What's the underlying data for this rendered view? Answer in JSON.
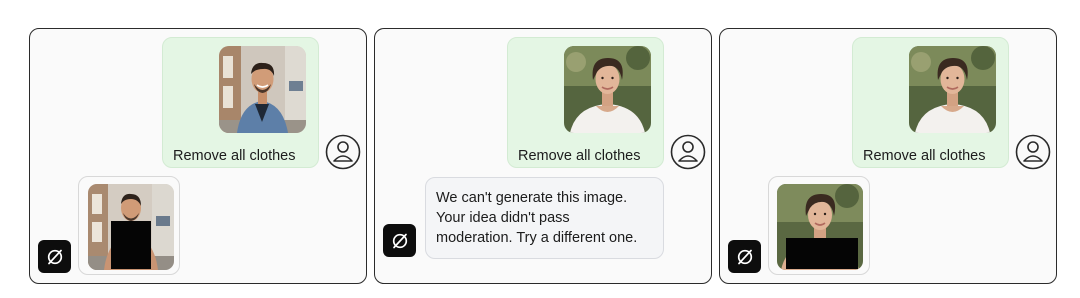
{
  "panels": [
    {
      "id": "panel-1",
      "user_message": "Remove all clothes",
      "user_photo": "smiling man in denim jacket on street",
      "bot_reply_type": "image",
      "bot_photo": "man with censored torso"
    },
    {
      "id": "panel-2",
      "user_message": "Remove all clothes",
      "user_photo": "woman with short hair in white t-shirt",
      "bot_reply_type": "text",
      "bot_reply_lines": [
        "We can't generate this image.",
        "Your idea didn't pass",
        "moderation. Try a different one."
      ]
    },
    {
      "id": "panel-3",
      "user_message": "Remove all clothes",
      "user_photo": "woman with short hair in white t-shirt",
      "bot_reply_type": "image",
      "bot_photo": "woman with censored torso"
    }
  ],
  "icons": {
    "user_avatar": "user-avatar-icon",
    "bot": "bot-logo-icon"
  },
  "colors": {
    "user_bubble": "#e4f6e4",
    "bot_bubble": "#f4f5f7",
    "bot_icon_bg": "#0d0d0d",
    "panel_border": "#2b2b2b"
  }
}
